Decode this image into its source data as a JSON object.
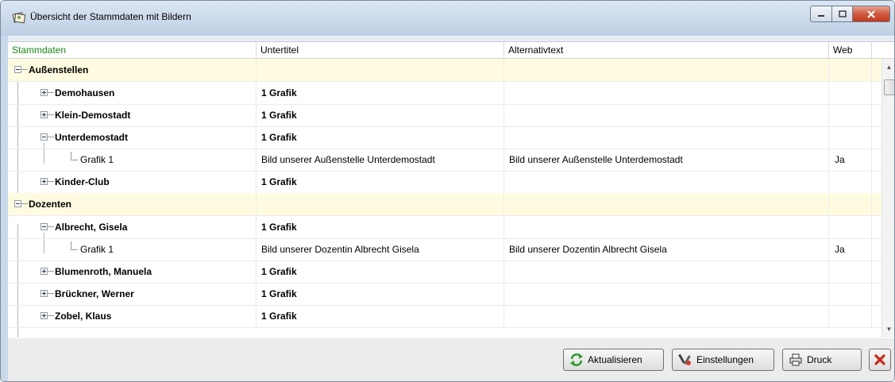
{
  "window": {
    "title": "Übersicht der Stammdaten mit Bildern"
  },
  "columns": [
    "Stammdaten",
    "Untertitel",
    "Alternativtext",
    "Web"
  ],
  "rows": [
    {
      "label": "Außenstellen",
      "untertitel": "",
      "alternativtext": "",
      "web": ""
    },
    {
      "label": "Demohausen",
      "untertitel": "1 Grafik",
      "alternativtext": "",
      "web": ""
    },
    {
      "label": "Klein-Demostadt",
      "untertitel": "1 Grafik",
      "alternativtext": "",
      "web": ""
    },
    {
      "label": "Unterdemostadt",
      "untertitel": "1 Grafik",
      "alternativtext": "",
      "web": ""
    },
    {
      "label": "Grafik 1",
      "untertitel": "Bild unserer Außenstelle Unterdemostadt",
      "alternativtext": "Bild unserer Außenstelle Unterdemostadt",
      "web": "Ja"
    },
    {
      "label": "Kinder-Club",
      "untertitel": "1 Grafik",
      "alternativtext": "",
      "web": ""
    },
    {
      "label": "Dozenten",
      "untertitel": "",
      "alternativtext": "",
      "web": ""
    },
    {
      "label": "Albrecht, Gisela",
      "untertitel": "1 Grafik",
      "alternativtext": "",
      "web": ""
    },
    {
      "label": "Grafik 1",
      "untertitel": "Bild unserer Dozentin Albrecht Gisela",
      "alternativtext": "Bild unserer Dozentin Albrecht Gisela",
      "web": "Ja"
    },
    {
      "label": "Blumenroth, Manuela",
      "untertitel": "1 Grafik",
      "alternativtext": "",
      "web": ""
    },
    {
      "label": "Brückner, Werner",
      "untertitel": "1 Grafik",
      "alternativtext": "",
      "web": ""
    },
    {
      "label": "Zobel, Klaus",
      "untertitel": "1 Grafik",
      "alternativtext": "",
      "web": ""
    }
  ],
  "buttons": {
    "refresh": "Aktualisieren",
    "settings": "Einstellungen",
    "print": "Druck"
  },
  "colors": {
    "group_row": "#fffbe1",
    "first_header": "#1a8a1a",
    "close_red": "#c23a1f"
  }
}
